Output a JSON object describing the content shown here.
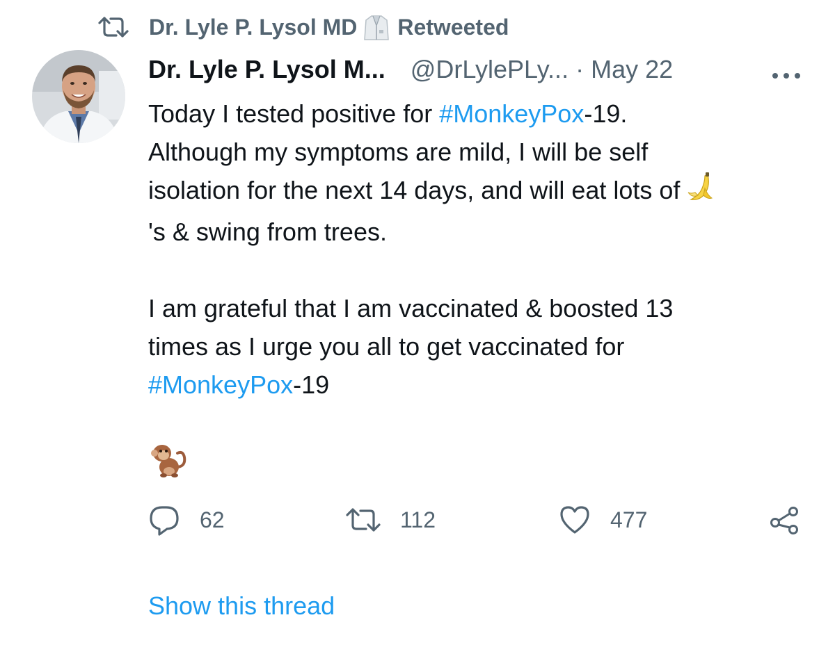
{
  "retweet_banner": {
    "user": "Dr. Lyle P. Lysol MD",
    "emoji_icon": "lab-coat-emoji",
    "status": "Retweeted"
  },
  "tweet": {
    "display_name": "Dr. Lyle P. Lysol M...",
    "handle": "@DrLylePLy...",
    "separator": "·",
    "date": "May 22",
    "text": {
      "line1_before": "Today I tested positive for ",
      "line1_hashtag": "#MonkeyPox",
      "line1_after": "-19.",
      "line2": "Although my symptoms are mild, I will be self",
      "line3": "isolation for the next 14 days, and will eat lots of ",
      "line3_emoji": "banana-emoji",
      "line4": "'s & swing from trees.",
      "line5": "I am grateful that I am vaccinated & boosted 13",
      "line6": "times as I urge you all to get vaccinated for",
      "line7_hashtag": "#MonkeyPox",
      "line7_after": "-19"
    },
    "trailing_emoji": "monkey-emoji",
    "actions": {
      "replies": "62",
      "retweets": "112",
      "likes": "477"
    },
    "show_thread_label": "Show this thread"
  },
  "colors": {
    "link": "#1d9bf0",
    "secondary_text": "#536471",
    "primary_text": "#0f1419",
    "background": "#ffffff"
  }
}
